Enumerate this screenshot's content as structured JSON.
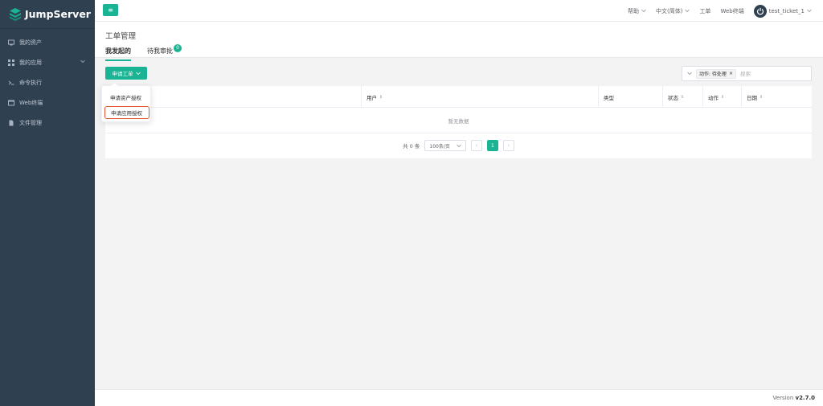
{
  "brand": {
    "name": "JumpServer",
    "accent": "#1ab394",
    "sidebar_bg": "#2f4050"
  },
  "sidebar": {
    "items": [
      {
        "label": "我的资产",
        "icon": "assets-icon"
      },
      {
        "label": "我的应用",
        "icon": "apps-icon",
        "expandable": true
      },
      {
        "label": "命令执行",
        "icon": "terminal-icon"
      },
      {
        "label": "Web终端",
        "icon": "web-terminal-icon"
      },
      {
        "label": "文件管理",
        "icon": "file-icon"
      }
    ]
  },
  "topbar": {
    "menu_icon": "≡",
    "help": "帮助",
    "language": "中文(简体)",
    "tickets": "工单",
    "web_terminal": "Web终端",
    "username": "test_ticket_1"
  },
  "page": {
    "title": "工单管理",
    "tabs": [
      {
        "label": "我发起的",
        "active": true
      },
      {
        "label": "待我审批",
        "badge": "0"
      }
    ]
  },
  "toolbar": {
    "apply_button": "申请工单",
    "filter_tag": "动作: 待处理",
    "search_placeholder": "搜索"
  },
  "dropdown": {
    "items": [
      "申请资产授权",
      "申请应用授权"
    ],
    "highlighted_index": 1
  },
  "table": {
    "columns": [
      "用户",
      "类型",
      "状态",
      "动作",
      "日期"
    ],
    "empty_text": "暂无数据"
  },
  "pagination": {
    "total": "共 0 条",
    "page_size": "100条/页",
    "current_page": "1"
  },
  "footer": {
    "version_label": "Version",
    "version": "v2.7.0"
  }
}
